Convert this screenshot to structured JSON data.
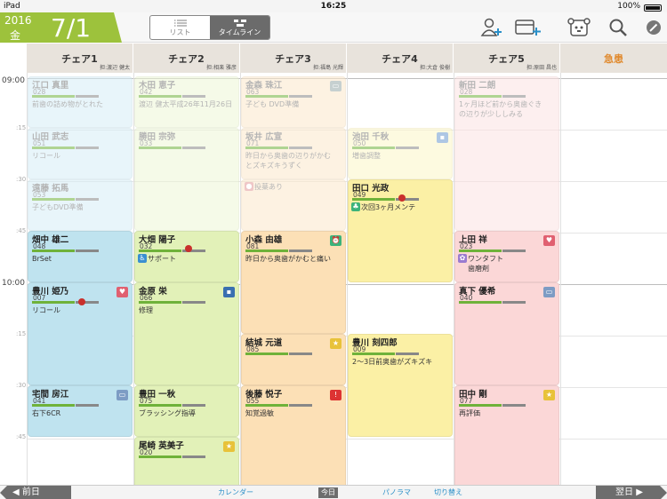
{
  "status": {
    "device": "iPad",
    "time": "16:25",
    "battery": "100%"
  },
  "header": {
    "year": "2016",
    "weekday": "金",
    "monthday": "7/1",
    "view_list": "リスト",
    "view_timeline": "タイムライン"
  },
  "columns": [
    {
      "name": "チェア1",
      "staff": "担:渡辺 健太"
    },
    {
      "name": "チェア2",
      "staff": "担:相楽 雅彦"
    },
    {
      "name": "チェア3",
      "staff": "担:福島 光輝"
    },
    {
      "name": "チェア4",
      "staff": "担:大倉 俊樹"
    },
    {
      "name": "チェア5",
      "staff": "担:原田 昌也"
    },
    {
      "name": "急患",
      "staff": ""
    }
  ],
  "times": [
    "09:00",
    ":15",
    ":30",
    ":45",
    "10:00",
    ":15",
    ":30",
    ":45"
  ],
  "appointments": [
    {
      "name": "江口 真里",
      "num": "028",
      "note": "前歯の詰め物がとれた"
    },
    {
      "name": "山田 武志",
      "num": "051",
      "note": "リコール"
    },
    {
      "name": "遠藤 拓馬",
      "num": "053",
      "note": "子どもDVD準備"
    },
    {
      "name": "畑中 雄二",
      "num": "048",
      "note": "BrSet"
    },
    {
      "name": "豊川 姫乃",
      "num": "007",
      "note": "リコール"
    },
    {
      "name": "宅間 房江",
      "num": "041",
      "note": "右下6CR"
    },
    {
      "name": "木田 恵子",
      "num": "042",
      "note": "渡辺 健太平成26年11月26日"
    },
    {
      "name": "勝田 宗弥",
      "num": "033",
      "note": ""
    },
    {
      "name": "大畑 陽子",
      "num": "032",
      "note": "サポート"
    },
    {
      "name": "金原 栄",
      "num": "066",
      "note": "修理"
    },
    {
      "name": "豊田 一秋",
      "num": "075",
      "note": "ブラッシング指導"
    },
    {
      "name": "尾崎 英美子",
      "num": "020",
      "note": ""
    },
    {
      "name": "金森 珠江",
      "num": "063",
      "note": "子ども DVD準備"
    },
    {
      "name": "坂井 広宣",
      "num": "071",
      "note": "昨日から奥歯の辺りがかむ\nとズキズキうずく"
    },
    {
      "name": "",
      "num": "",
      "note": "投薬あり"
    },
    {
      "name": "小森 由雄",
      "num": "081",
      "note": "昨日から奥歯がかむと痛い"
    },
    {
      "name": "結城 元道",
      "num": "085",
      "note": ""
    },
    {
      "name": "後藤 悦子",
      "num": "055",
      "note": "知覚過敏"
    },
    {
      "name": "池田 千秋",
      "num": "050",
      "note": "増歯調整"
    },
    {
      "name": "田口 光政",
      "num": "049",
      "note": "次回3ヶ月メンテ"
    },
    {
      "name": "豊川 刻四郎",
      "num": "009",
      "note": "2〜3日前奥歯がズキズキ"
    },
    {
      "name": "新田 二朗",
      "num": "028",
      "note": "1ヶ月ほど前から奥歯ぐき\nの辺りが少ししみる"
    },
    {
      "name": "上田 祥",
      "num": "023",
      "note": "ワンタフト\n歯磨剤"
    },
    {
      "name": "真下 優希",
      "num": "040",
      "note": ""
    },
    {
      "name": "田中 剛",
      "num": "077",
      "note": "再評価"
    }
  ],
  "bottom": {
    "prev": "前日",
    "calendar": "カレンダー",
    "today": "今日",
    "panorama": "パノラマ",
    "switch": "切り替え",
    "next": "翌日"
  },
  "colors": {
    "accent": "#9dc23c",
    "link": "#2a8fc8",
    "urgent": "#e08a2e"
  }
}
